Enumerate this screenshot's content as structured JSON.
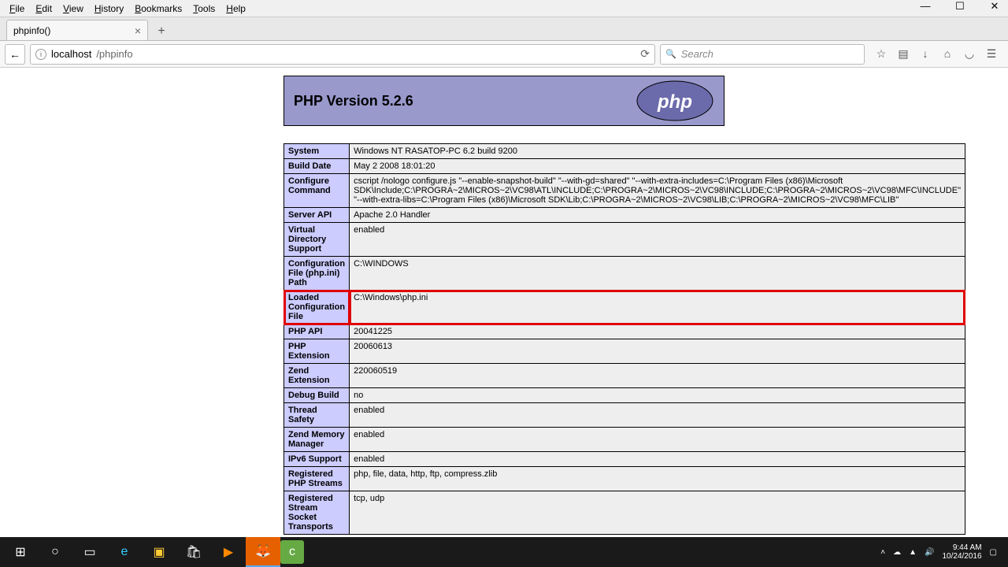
{
  "menu": [
    "File",
    "Edit",
    "View",
    "History",
    "Bookmarks",
    "Tools",
    "Help"
  ],
  "tab": {
    "title": "phpinfo()"
  },
  "url": {
    "host": "localhost",
    "path": "/phpinfo"
  },
  "search": {
    "placeholder": "Search"
  },
  "php": {
    "title": "PHP Version 5.2.6",
    "rows": [
      {
        "k": "System",
        "v": "Windows NT RASATOP-PC 6.2 build 9200"
      },
      {
        "k": "Build Date",
        "v": "May 2 2008 18:01:20"
      },
      {
        "k": "Configure Command",
        "v": "cscript /nologo configure.js \"--enable-snapshot-build\" \"--with-gd=shared\" \"--with-extra-includes=C:\\Program Files (x86)\\Microsoft SDK\\Include;C:\\PROGRA~2\\MICROS~2\\VC98\\ATL\\INCLUDE;C:\\PROGRA~2\\MICROS~2\\VC98\\INCLUDE;C:\\PROGRA~2\\MICROS~2\\VC98\\MFC\\INCLUDE\" \"--with-extra-libs=C:\\Program Files (x86)\\Microsoft SDK\\Lib;C:\\PROGRA~2\\MICROS~2\\VC98\\LIB;C:\\PROGRA~2\\MICROS~2\\VC98\\MFC\\LIB\""
      },
      {
        "k": "Server API",
        "v": "Apache 2.0 Handler"
      },
      {
        "k": "Virtual Directory Support",
        "v": "enabled"
      },
      {
        "k": "Configuration File (php.ini) Path",
        "v": "C:\\WINDOWS"
      },
      {
        "k": "Loaded Configuration File",
        "v": "C:\\Windows\\php.ini",
        "hl": true
      },
      {
        "k": "PHP API",
        "v": "20041225"
      },
      {
        "k": "PHP Extension",
        "v": "20060613"
      },
      {
        "k": "Zend Extension",
        "v": "220060519"
      },
      {
        "k": "Debug Build",
        "v": "no"
      },
      {
        "k": "Thread Safety",
        "v": "enabled"
      },
      {
        "k": "Zend Memory Manager",
        "v": "enabled"
      },
      {
        "k": "IPv6 Support",
        "v": "enabled"
      },
      {
        "k": "Registered PHP Streams",
        "v": "php, file, data, http, ftp, compress.zlib"
      },
      {
        "k": "Registered Stream Socket Transports",
        "v": "tcp, udp"
      }
    ]
  },
  "tray": {
    "time": "9:44 AM",
    "date": "10/24/2016"
  }
}
